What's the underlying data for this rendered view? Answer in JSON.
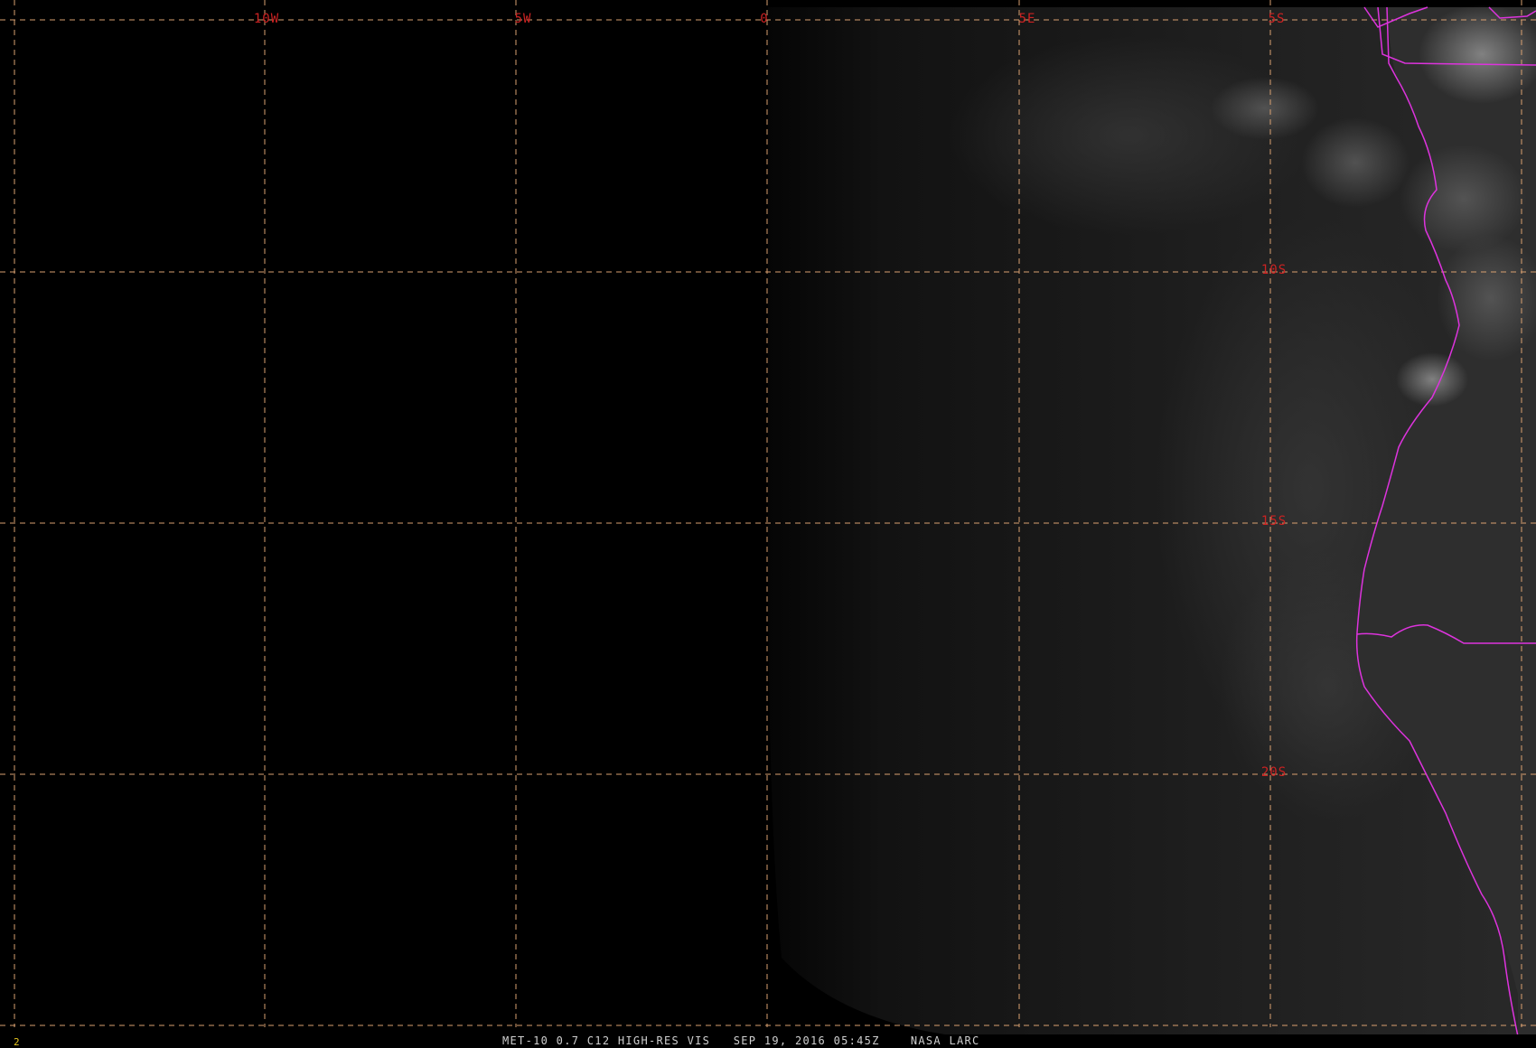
{
  "colors": {
    "background": "#000000",
    "graticule": "#d9a070",
    "grid_label": "#cc2222",
    "coastline": "#dd33dd",
    "status_text": "#cfcfcf",
    "frame_number": "#e6c620"
  },
  "graticule": {
    "longitude_labels": [
      "10W",
      "5W",
      "0",
      "5E"
    ],
    "latitude_labels": [
      "5S",
      "10S",
      "15S",
      "20S"
    ]
  },
  "status_bar": {
    "frame_number": "2",
    "satellite": "MET-10 0.7 C12 HIGH-RES VIS",
    "datetime": "SEP 19, 2016 05:45Z",
    "source": "NASA LARC"
  }
}
